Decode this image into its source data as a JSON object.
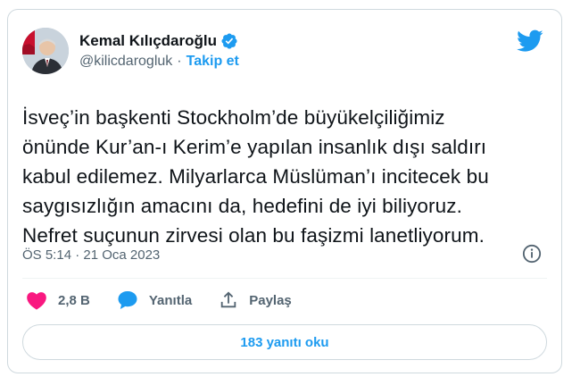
{
  "author": {
    "name": "Kemal Kılıçdaroğlu",
    "handle": "@kilicdarogluk",
    "separator": "·",
    "follow_label": "Takip et"
  },
  "tweet": {
    "text": "İsveç’in başkenti Stockholm’de büyükelçiliğimiz\nönünde Kur’an-ı Kerim’e yapılan insanlık dışı saldırı\nkabul edilemez. Milyarlarca Müslüman’ı incitecek bu\nsaygısızlığın amacını da, hedefini de iyi biliyoruz.\nNefret suçunun zirvesi olan bu faşizmi lanetliyorum.",
    "timestamp": "ÖS 5:14 · 21 Oca 2023"
  },
  "actions": {
    "likes_count": "2,8 B",
    "reply_label": "Yanıtla",
    "share_label": "Paylaş"
  },
  "replies_button_label": "183 yanıtı oku",
  "icons": {
    "verified": "verified-badge-icon",
    "logo": "twitter-bird-icon",
    "info": "info-icon",
    "like": "heart-icon",
    "reply": "speech-bubble-icon",
    "share": "share-upload-icon"
  },
  "colors": {
    "accent": "#1d9bf0",
    "like": "#f91880",
    "text": "#0f1419",
    "secondary": "#536471"
  }
}
